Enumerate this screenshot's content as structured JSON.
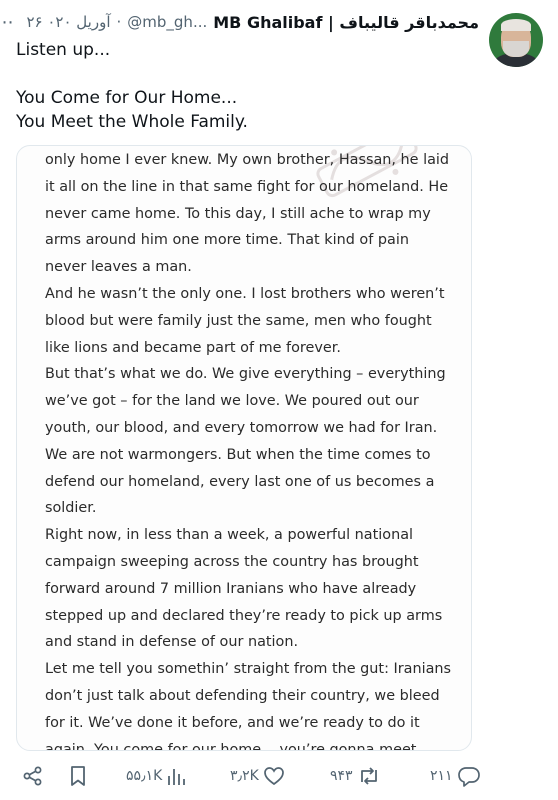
{
  "header": {
    "name": "MB Ghalibaf | محمدباقر قالیباف",
    "handle": "@mb_gh...",
    "separator": "·",
    "date": "۲۶ آوریل ۰۲۰",
    "more_icon": "more-dots-icon"
  },
  "tweet": {
    "lines": [
      "Listen up...",
      "",
      "You Come for Our Home...",
      "You Meet the Whole Family."
    ]
  },
  "card": {
    "watermark": "فرهیختگان",
    "lines": [
      "only home I ever knew. My own brother, Hassan, he laid",
      "it all on the line in that same fight for our homeland. He",
      "never came home. To this day, I still ache to wrap my",
      "arms around him one more time. That kind of pain",
      "never leaves a man.",
      "And he wasn’t the only one. I lost brothers who weren’t",
      "blood but were family just the same, men who fought",
      "like lions and became part of me forever.",
      "But that’s what we do. We give everything – everything",
      "we’ve got – for the land we love. We poured out our",
      "youth, our blood, and every tomorrow we had for Iran.",
      "We are not warmongers. But when the time comes to",
      "defend our homeland, every last one of us becomes a",
      "soldier.",
      "Right now, in less than a week, a powerful national",
      "campaign sweeping across the country has brought",
      "forward around 7 million Iranians who have already",
      "stepped up and declared they’re ready to pick up arms",
      "and stand in defense of our nation.",
      "Let me tell you somethin’ straight from the gut: Iranians",
      "don’t just talk about defending their country, we bleed",
      "for it. We’ve done it before, and we’re ready to do it",
      "again. You come for our home... you’re gonna meet"
    ]
  },
  "actions": {
    "share_icon": "share-icon",
    "bookmark_icon": "bookmark-icon",
    "views": "۵۵٫۱K",
    "views_icon": "views-bar-icon",
    "likes": "۳٫۲K",
    "likes_icon": "heart-icon",
    "reposts": "۹۴۳",
    "reposts_icon": "repost-icon",
    "replies": "۲۱۱",
    "replies_icon": "reply-icon"
  }
}
